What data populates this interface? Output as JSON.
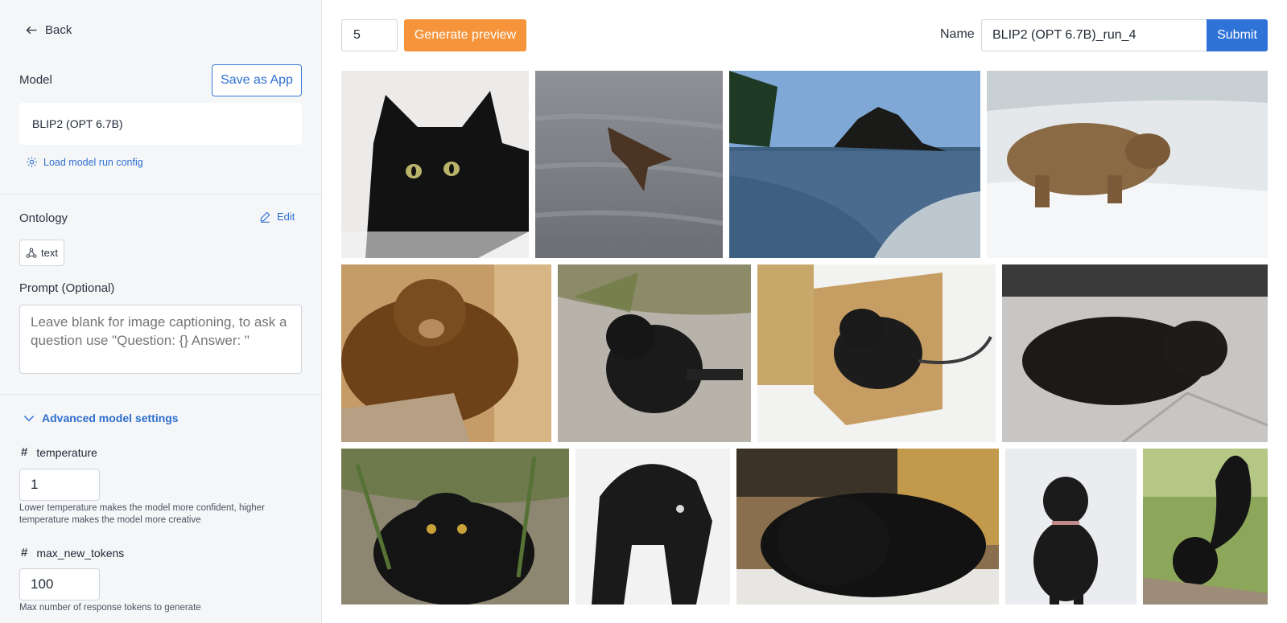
{
  "sidebar": {
    "back_label": "Back",
    "model_label": "Model",
    "save_app_label": "Save as App",
    "model_value": "BLIP2 (OPT 6.7B)",
    "load_config_label": "Load model run config",
    "ontology_label": "Ontology",
    "edit_label": "Edit",
    "ontology_chip": "text",
    "prompt_label": "Prompt (Optional)",
    "prompt_placeholder": "Leave blank for image captioning, to ask a question use \"Question: {} Answer: \"",
    "advanced_label": "Advanced model settings",
    "params": [
      {
        "name": "temperature",
        "value": "1",
        "help": "Lower temperature makes the model more confident, higher temperature makes the model more creative"
      },
      {
        "name": "max_new_tokens",
        "value": "100",
        "help": "Max number of response tokens to generate"
      }
    ]
  },
  "toolbar": {
    "count_value": "5",
    "generate_label": "Generate preview",
    "name_label": "Name",
    "name_value": "BLIP2 (OPT 6.7B)_run_4",
    "submit_label": "Submit"
  },
  "colors": {
    "accent_blue": "#2f73d8",
    "accent_orange": "#f5943b",
    "sidebar_bg": "#f5f6f8"
  },
  "gallery": {
    "tiles": [
      {
        "icon": "black-cat-closeup-image"
      },
      {
        "icon": "bat-over-water-image"
      },
      {
        "icon": "beach-sea-stack-image"
      },
      {
        "icon": "bear-waterfall-image"
      },
      {
        "icon": "brown-bear-image"
      },
      {
        "icon": "black-cat-outdoors-image"
      },
      {
        "icon": "cat-in-box-image"
      },
      {
        "icon": "cat-lying-image"
      },
      {
        "icon": "black-cat-plants-image"
      },
      {
        "icon": "arched-black-cat-image"
      },
      {
        "icon": "sleeping-black-dog-image"
      },
      {
        "icon": "black-dog-snow-image"
      },
      {
        "icon": "black-squirrel-image"
      }
    ]
  }
}
